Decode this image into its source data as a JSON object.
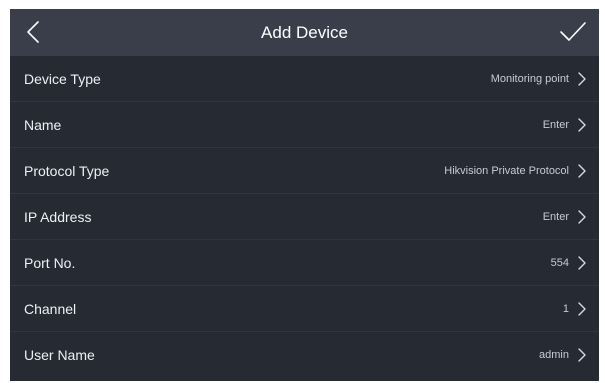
{
  "header": {
    "title": "Add Device",
    "back_icon": "chevron-left-icon",
    "confirm_icon": "check-icon"
  },
  "rows": [
    {
      "label": "Device Type",
      "value": "Monitoring point"
    },
    {
      "label": "Name",
      "value": "Enter"
    },
    {
      "label": "Protocol Type",
      "value": "Hikvision Private Protocol"
    },
    {
      "label": "IP Address",
      "value": "Enter"
    },
    {
      "label": "Port No.",
      "value": "554"
    },
    {
      "label": "Channel",
      "value": "1"
    },
    {
      "label": "User Name",
      "value": "admin"
    }
  ],
  "colors": {
    "topbar": "#3a3e4b",
    "background": "#262a33",
    "text": "#eef0f4",
    "value_text": "#c7cbd4"
  }
}
